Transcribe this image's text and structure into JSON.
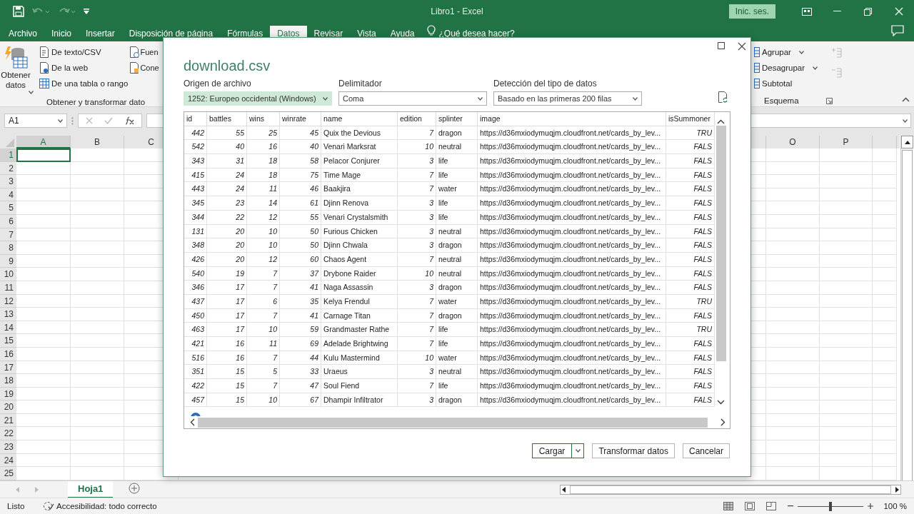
{
  "window": {
    "title": "Libro1 - Excel",
    "sign_in": "Inic. ses."
  },
  "ribbon_tabs": [
    {
      "label": "Archivo",
      "selected": false
    },
    {
      "label": "Inicio",
      "selected": false
    },
    {
      "label": "Insertar",
      "selected": false
    },
    {
      "label": "Disposición de página",
      "selected": false
    },
    {
      "label": "Fórmulas",
      "selected": false
    },
    {
      "label": "Datos",
      "selected": true
    },
    {
      "label": "Revisar",
      "selected": false
    },
    {
      "label": "Vista",
      "selected": false
    },
    {
      "label": "Ayuda",
      "selected": false
    }
  ],
  "tell_me": "¿Qué desea hacer?",
  "ribbon": {
    "get_data": "Obtener datos",
    "import_items": [
      {
        "label": "De texto/CSV"
      },
      {
        "label": "De la web"
      },
      {
        "label": "De una tabla o rango"
      }
    ],
    "source_items": [
      {
        "label": "Fuen"
      },
      {
        "label": "Cone"
      }
    ],
    "group_label": "Obtener y transformar dato",
    "outline_items": [
      {
        "label": "Agrupar",
        "dropdown": true
      },
      {
        "label": "Desagrupar",
        "dropdown": true
      },
      {
        "label": "Subtotal",
        "dropdown": false
      }
    ],
    "outline_label": "Esquema"
  },
  "formula_bar": {
    "name_box": "A1"
  },
  "sheet": {
    "columns": [
      {
        "label": "A",
        "selected": true
      },
      {
        "label": "B",
        "selected": false
      },
      {
        "label": "C",
        "selected": false
      },
      {
        "label": "O",
        "selected": false
      },
      {
        "label": "P",
        "selected": false
      }
    ],
    "rows": [
      {
        "label": "1",
        "selected": true
      },
      {
        "label": "2",
        "selected": false
      },
      {
        "label": "3",
        "selected": false
      },
      {
        "label": "4",
        "selected": false
      },
      {
        "label": "5",
        "selected": false
      },
      {
        "label": "6",
        "selected": false
      },
      {
        "label": "7",
        "selected": false
      },
      {
        "label": "8",
        "selected": false
      },
      {
        "label": "9",
        "selected": false
      },
      {
        "label": "10",
        "selected": false
      },
      {
        "label": "11",
        "selected": false
      },
      {
        "label": "12",
        "selected": false
      },
      {
        "label": "13",
        "selected": false
      },
      {
        "label": "14",
        "selected": false
      },
      {
        "label": "15",
        "selected": false
      },
      {
        "label": "16",
        "selected": false
      },
      {
        "label": "17",
        "selected": false
      },
      {
        "label": "18",
        "selected": false
      },
      {
        "label": "19",
        "selected": false
      },
      {
        "label": "20",
        "selected": false
      },
      {
        "label": "21",
        "selected": false
      },
      {
        "label": "22",
        "selected": false
      },
      {
        "label": "23",
        "selected": false
      },
      {
        "label": "24",
        "selected": false
      },
      {
        "label": "25",
        "selected": false
      }
    ]
  },
  "sheet_tabs": [
    {
      "label": "Hoja1",
      "selected": true
    }
  ],
  "status_bar": {
    "mode": "Listo",
    "accessibility": "Accesibilidad: todo correcto",
    "zoom": "100 %",
    "zoom_slider": {
      "level": 0.5
    }
  },
  "dialog": {
    "title": "download.csv",
    "fields": [
      {
        "label": "Origen de archivo",
        "value": "1252: Europeo occidental (Windows)",
        "focused": true
      },
      {
        "label": "Delimitador",
        "value": "Coma",
        "focused": false
      },
      {
        "label": "Detección del tipo de datos",
        "value": "Basado en las primeras 200 filas",
        "focused": false
      }
    ],
    "table": {
      "columns": [
        {
          "label": "id",
          "kind": "number"
        },
        {
          "label": "battles",
          "kind": "number"
        },
        {
          "label": "wins",
          "kind": "number"
        },
        {
          "label": "winrate",
          "kind": "number"
        },
        {
          "label": "name",
          "kind": "text"
        },
        {
          "label": "edition",
          "kind": "number"
        },
        {
          "label": "splinter",
          "kind": "text"
        },
        {
          "label": "image",
          "kind": "text"
        },
        {
          "label": "isSummoner",
          "kind": "number"
        }
      ],
      "rows": [
        [
          "442",
          "55",
          "25",
          "45",
          "Quix the Devious",
          "7",
          "dragon",
          "https://d36mxiodymuqjm.cloudfront.net/cards_by_lev...",
          "TRU"
        ],
        [
          "542",
          "40",
          "16",
          "40",
          "Venari Marksrat",
          "10",
          "neutral",
          "https://d36mxiodymuqjm.cloudfront.net/cards_by_lev...",
          "FALS"
        ],
        [
          "343",
          "31",
          "18",
          "58",
          "Pelacor Conjurer",
          "3",
          "life",
          "https://d36mxiodymuqjm.cloudfront.net/cards_by_lev...",
          "FALS"
        ],
        [
          "415",
          "24",
          "18",
          "75",
          "Time Mage",
          "7",
          "life",
          "https://d36mxiodymuqjm.cloudfront.net/cards_by_lev...",
          "FALS"
        ],
        [
          "443",
          "24",
          "11",
          "46",
          "Baakjira",
          "7",
          "water",
          "https://d36mxiodymuqjm.cloudfront.net/cards_by_lev...",
          "FALS"
        ],
        [
          "345",
          "23",
          "14",
          "61",
          "Djinn Renova",
          "3",
          "life",
          "https://d36mxiodymuqjm.cloudfront.net/cards_by_lev...",
          "FALS"
        ],
        [
          "344",
          "22",
          "12",
          "55",
          "Venari Crystalsmith",
          "3",
          "life",
          "https://d36mxiodymuqjm.cloudfront.net/cards_by_lev...",
          "FALS"
        ],
        [
          "131",
          "20",
          "10",
          "50",
          "Furious Chicken",
          "3",
          "neutral",
          "https://d36mxiodymuqjm.cloudfront.net/cards_by_lev...",
          "FALS"
        ],
        [
          "348",
          "20",
          "10",
          "50",
          "Djinn Chwala",
          "3",
          "dragon",
          "https://d36mxiodymuqjm.cloudfront.net/cards_by_lev...",
          "FALS"
        ],
        [
          "426",
          "20",
          "12",
          "60",
          "Chaos Agent",
          "7",
          "neutral",
          "https://d36mxiodymuqjm.cloudfront.net/cards_by_lev...",
          "FALS"
        ],
        [
          "540",
          "19",
          "7",
          "37",
          "Drybone Raider",
          "10",
          "neutral",
          "https://d36mxiodymuqjm.cloudfront.net/cards_by_lev...",
          "FALS"
        ],
        [
          "346",
          "17",
          "7",
          "41",
          "Naga Assassin",
          "3",
          "dragon",
          "https://d36mxiodymuqjm.cloudfront.net/cards_by_lev...",
          "FALS"
        ],
        [
          "437",
          "17",
          "6",
          "35",
          "Kelya Frendul",
          "7",
          "water",
          "https://d36mxiodymuqjm.cloudfront.net/cards_by_lev...",
          "TRU"
        ],
        [
          "450",
          "17",
          "7",
          "41",
          "Carnage Titan",
          "7",
          "dragon",
          "https://d36mxiodymuqjm.cloudfront.net/cards_by_lev...",
          "FALS"
        ],
        [
          "463",
          "17",
          "10",
          "59",
          "Grandmaster Rathe",
          "7",
          "life",
          "https://d36mxiodymuqjm.cloudfront.net/cards_by_lev...",
          "TRU"
        ],
        [
          "421",
          "16",
          "11",
          "69",
          "Adelade Brightwing",
          "7",
          "life",
          "https://d36mxiodymuqjm.cloudfront.net/cards_by_lev...",
          "FALS"
        ],
        [
          "516",
          "16",
          "7",
          "44",
          "Kulu Mastermind",
          "10",
          "water",
          "https://d36mxiodymuqjm.cloudfront.net/cards_by_lev...",
          "FALS"
        ],
        [
          "351",
          "15",
          "5",
          "33",
          "Uraeus",
          "3",
          "neutral",
          "https://d36mxiodymuqjm.cloudfront.net/cards_by_lev...",
          "FALS"
        ],
        [
          "422",
          "15",
          "7",
          "47",
          "Soul Fiend",
          "7",
          "life",
          "https://d36mxiodymuqjm.cloudfront.net/cards_by_lev...",
          "FALS"
        ],
        [
          "457",
          "15",
          "10",
          "67",
          "Dhampir Infiltrator",
          "3",
          "dragon",
          "https://d36mxiodymuqjm.cloudfront.net/cards_by_lev...",
          "FALS"
        ]
      ]
    },
    "buttons": [
      {
        "label": "Cargar",
        "kind": "split"
      },
      {
        "label": "Transformar datos",
        "kind": "normal"
      },
      {
        "label": "Cancelar",
        "kind": "normal"
      }
    ]
  }
}
